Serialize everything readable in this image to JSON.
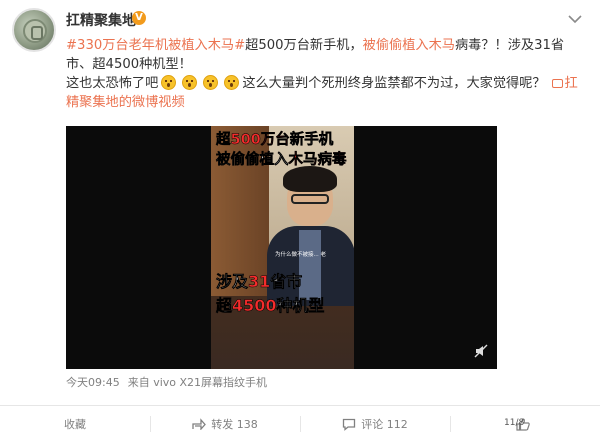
{
  "header": {
    "username": "扛精聚集地",
    "vip_badge": "V"
  },
  "post": {
    "hashtag_text": "#330万台老年机被植入木马#",
    "text_part1": "超500万台新手机，",
    "highlight1": "被偷偷植入木马",
    "text_part2": "病毒？！涉及31省市、超4500种机型！",
    "text_part3": "这也太恐怖了吧",
    "text_part4": "这么大量判个死刑终身监禁都不为过，大家觉得呢？",
    "video_link_label": "扛精聚集地的微博视频"
  },
  "video": {
    "caption_line1_a": "超",
    "caption_line1_b": "500万台",
    "caption_line1_c": "新手机",
    "caption_line2_a": "被偷偷植入",
    "caption_line2_b": "木马病毒",
    "caption_line3_a": "涉及",
    "caption_line3_b": "31",
    "caption_line3_c": "省市",
    "caption_line4_a": "超",
    "caption_line4_b": "4500",
    "caption_line4_c": "种机型",
    "subtitle_small": "为什么做不被接... 老"
  },
  "meta": {
    "time": "今天09:45",
    "source": "来自 vivo X21屏幕指纹手机"
  },
  "actions": {
    "favorite_label": "收藏",
    "share_label": "转发 138",
    "comment_label": "评论 112",
    "like_label": "",
    "page_badge": "11/8"
  },
  "icons": {
    "more": "chevron-down-icon",
    "share": "share-icon",
    "comment": "comment-icon",
    "like": "thumb-up-icon"
  },
  "colors": {
    "accent": "#eb7350",
    "caption_red": "#f52c2c",
    "text": "#333333",
    "muted": "#808080"
  }
}
